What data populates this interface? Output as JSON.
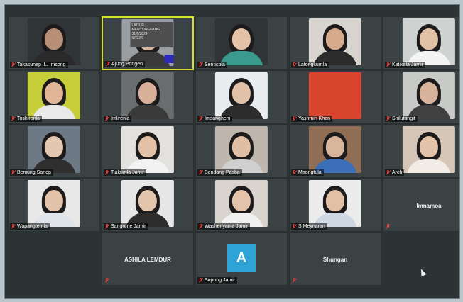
{
  "tiles": [
    {
      "name": "Takasunep .L. Imsong",
      "muted": true,
      "bg": "#2f3436",
      "skin": "#b89078",
      "shirt": "#2a2a2a"
    },
    {
      "name": "Ajung Pongen",
      "muted": true,
      "active": true,
      "board_text": [
        "LATIUR MENYONGPANG",
        "31/6/2024",
        "97/22/9"
      ],
      "bg": "#9a9ea0",
      "skin": "#d8b49a",
      "shirt": "#3a3a3a"
    },
    {
      "name": "Sentisola",
      "muted": true,
      "bg": "#2f3436",
      "skin": "#e4c2a8",
      "shirt": "#3a9a8e"
    },
    {
      "name": "Latongkumla",
      "muted": true,
      "bg": "#d8d4cf",
      "skin": "#d6aa8c",
      "shirt": "#2c2c2c"
    },
    {
      "name": "Katikala Jamir",
      "muted": true,
      "bg": "#cfd3d2",
      "skin": "#e2c2a7",
      "shirt": "#f4f4f4"
    },
    {
      "name": "Toshirenla",
      "muted": true,
      "bg": "#c6cf3a",
      "skin": "#e1b696",
      "shirt": "#e9e9e9"
    },
    {
      "name": "Imlirenla",
      "muted": true,
      "bg": "#6a6d6e",
      "skin": "#d8b09a",
      "shirt": "#3a3a3a"
    },
    {
      "name": "Imsangheni",
      "muted": true,
      "bg": "#e9edf0",
      "skin": "#e1c1a8",
      "shirt": "#2c2c2c"
    },
    {
      "name": "Yashmin Khan",
      "muted": true,
      "bg": "#d9442f",
      "skin": "#d9442f",
      "shirt": "#d9442f",
      "no_person": true
    },
    {
      "name": "Shilutangit",
      "muted": true,
      "bg": "#c8cac7",
      "skin": "#d7b39b",
      "shirt": "#404040"
    },
    {
      "name": "Benjung Sanep",
      "muted": true,
      "bg": "#6d7a86",
      "skin": "#e4c7b1",
      "shirt": "#2f2f2f"
    },
    {
      "name": "Tiakumla Jamir",
      "muted": true,
      "bg": "#e3e1de",
      "skin": "#e2c1a7",
      "shirt": "#f2f2f2"
    },
    {
      "name": "Bendang Pasba",
      "muted": true,
      "bg": "#bfb6ad",
      "skin": "#e0bea4",
      "shirt": "#cfcfcf"
    },
    {
      "name": "Maongtula",
      "muted": true,
      "bg": "#8f6e55",
      "skin": "#d9b59b",
      "shirt": "#3b6fb8"
    },
    {
      "name": "Arch",
      "muted": true,
      "bg": "#d5c6b8",
      "skin": "#e2c2a8",
      "shirt": "#f2ece6"
    },
    {
      "name": "Wapangtemla",
      "muted": true,
      "bg": "#e8e8e8",
      "skin": "#e2c2a8",
      "shirt": "#dfe4ea"
    },
    {
      "name": "Sangrone Jamir",
      "muted": true,
      "bg": "#e6e6e6",
      "skin": "#e3c5ad",
      "shirt": "#2d2d2d"
    },
    {
      "name": "Washenyanla Jamir",
      "muted": true,
      "bg": "#d9d4ce",
      "skin": "#e3c3aa",
      "shirt": "#f0f0f0"
    },
    {
      "name": "S Meynaran",
      "muted": true,
      "bg": "#ececec",
      "skin": "#e1c0a6",
      "shirt": "#cfd7e2"
    },
    {
      "name": "Imnamoa",
      "muted": true,
      "center_label": true
    },
    {
      "empty": true
    },
    {
      "name": "ASHILA LEMDUR",
      "muted": true,
      "center_label": true
    },
    {
      "name": "Supong Jamir",
      "muted": true,
      "avatar_letter": "A"
    },
    {
      "name": "Shungan",
      "muted": true,
      "center_label": true
    },
    {
      "empty": true
    }
  ]
}
